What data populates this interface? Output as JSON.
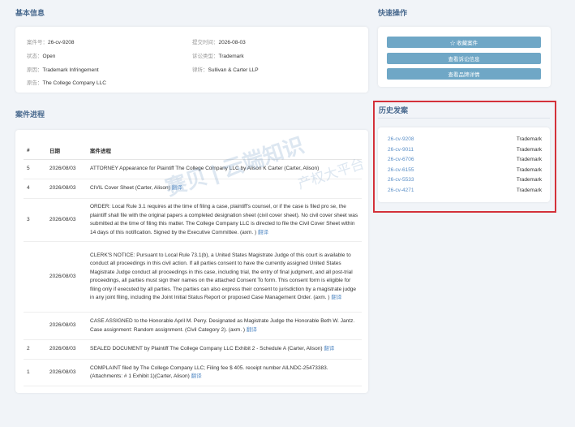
{
  "basic": {
    "title": "基本信息",
    "case_no_label": "案件号：",
    "case_no": "26-cv-9208",
    "submit_label": "提交时间：",
    "submit": "2026-08-03",
    "status_label": "状态：",
    "status": "Open",
    "type_label": "诉讼类型：",
    "type": "Trademark",
    "cause_label": "原因：",
    "cause": "Trademark Infringement",
    "lawyer_label": "律所：",
    "lawyer": "Sullivan & Carter LLP",
    "plaintiff_label": "原告：",
    "plaintiff": "The College Company LLC"
  },
  "quick": {
    "title": "快速操作",
    "btn1": "☆ 收藏案件",
    "btn2": "查看诉讼信息",
    "btn3": "查看品牌详情"
  },
  "history": {
    "title": "历史发案",
    "items": [
      {
        "case": "26-cv-9208",
        "type": "Trademark"
      },
      {
        "case": "26-cv-9011",
        "type": "Trademark"
      },
      {
        "case": "26-cv-6706",
        "type": "Trademark"
      },
      {
        "case": "26-cv-6155",
        "type": "Trademark"
      },
      {
        "case": "26-cv-5533",
        "type": "Trademark"
      },
      {
        "case": "26-cv-4271",
        "type": "Trademark"
      }
    ]
  },
  "progress": {
    "title": "案件进程",
    "headers": [
      "#",
      "日期",
      "案件进程"
    ],
    "translate": "翻译",
    "rows": [
      {
        "num": "5",
        "date": "2026/08/03",
        "text": "ATTORNEY Appearance for Plaintiff The College Company LLC by Alison K Carter (Carter, Alison)"
      },
      {
        "num": "4",
        "date": "2026/08/03",
        "text": "CIVIL Cover Sheet (Carter, Alison)"
      },
      {
        "num": "3",
        "date": "2026/08/03",
        "text": "ORDER: Local Rule 3.1 requires at the time of filing a case, plaintiff's counsel, or if the case is filed pro se, the plaintiff shall file with the original papers a completed designation sheet (civil cover sheet). No civil cover sheet was submitted at the time of filing this matter. The College Company LLC is directed to file the Civil Cover Sheet within 14 days of this notification. Signed by the Executive Committee. (axm. )"
      },
      {
        "num": "",
        "date": "2026/08/03",
        "text": "CLERK'S NOTICE: Pursuant to Local Rule 73.1(b), a United States Magistrate Judge of this court is available to conduct all proceedings in this civil action. If all parties consent to have the currently assigned United States Magistrate Judge conduct all proceedings in this case, including trial, the entry of final judgment, and all post-trial proceedings, all parties must sign their names on the attached Consent To form. This consent form is eligible for filing only if executed by all parties. The parties can also express their consent to jurisdiction by a magistrate judge in any joint filing, including the Joint Initial Status Report or proposed Case Management Order. (axm. )"
      },
      {
        "num": "",
        "date": "2026/08/03",
        "text": "CASE ASSIGNED to the Honorable April M. Perry. Designated as Magistrate Judge the Honorable Beth W. Jantz. Case assignment: Random assignment. (Civil Category 2). (axm. )"
      },
      {
        "num": "2",
        "date": "2026/08/03",
        "text": "SEALED DOCUMENT by Plaintiff The College Company LLC Exhibit 2 - Schedule A (Carter, Alison)"
      },
      {
        "num": "1",
        "date": "2026/08/03",
        "text": "COMPLAINT filed by The College Company LLC; Filing fee $ 405. receipt number AILNDC-25473383. (Attachments: # 1 Exhibit 1)(Carter, Alison)"
      }
    ]
  },
  "watermark": {
    "main": "赛贝 | 云端知识",
    "sub": "产权大平台"
  }
}
